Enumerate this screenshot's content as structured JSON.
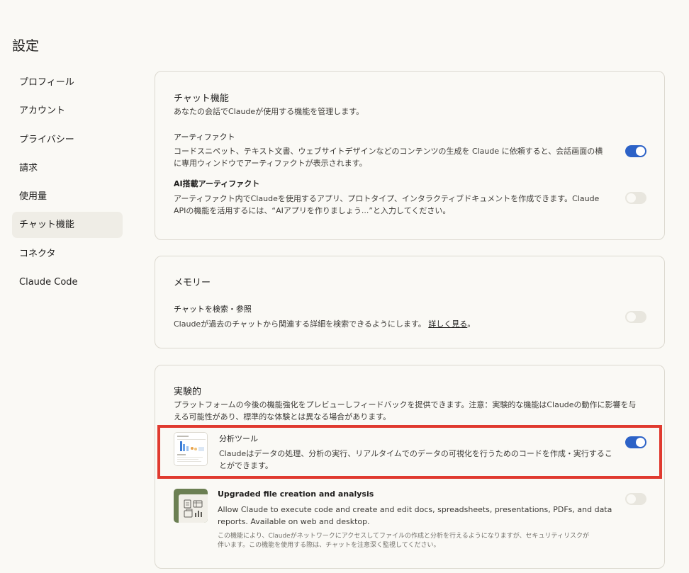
{
  "page": {
    "title": "設定"
  },
  "sidebar": {
    "items": [
      {
        "label": "プロフィール",
        "active": false
      },
      {
        "label": "アカウント",
        "active": false
      },
      {
        "label": "プライバシー",
        "active": false
      },
      {
        "label": "請求",
        "active": false
      },
      {
        "label": "使用量",
        "active": false
      },
      {
        "label": "チャット機能",
        "active": true
      },
      {
        "label": "コネクタ",
        "active": false
      },
      {
        "label": "Claude Code",
        "active": false
      }
    ]
  },
  "chat_features": {
    "title": "チャット機能",
    "description": "あなたの会話でClaudeが使用する機能を管理します。",
    "artifacts": {
      "label": "アーティファクト",
      "desc_line1": "コードスニペット、テキスト文書、ウェブサイトデザインなどのコンテンツの生成を Claude に依頼すると、会話画面の横",
      "desc_line2": "に専用ウィンドウでアーティファクトが表示されます。",
      "enabled": true
    },
    "ai_artifacts": {
      "label": "AI搭載アーティファクト",
      "desc_line1": "アーティファクト内でClaudeを使用するアプリ、プロトタイプ、インタラクティブドキュメントを作成できます。Claude",
      "desc_line2": "APIの機能を活用するには、“AIアプリを作りましょう...”と入力してください。",
      "enabled": false
    }
  },
  "memory": {
    "title": "メモリー",
    "search_chats": {
      "label": "チャットを検索・参照",
      "desc": "Claudeが過去のチャットから関連する詳細を検索できるようにします。",
      "link": "詳しく見る",
      "link_suffix": "。",
      "enabled": false
    }
  },
  "experimental": {
    "title": "実験的",
    "desc_line1": "プラットフォームの今後の機能強化をプレビューしフィードバックを提供できます。注意：実験的な機能はClaudeの動作に影響を与",
    "desc_line2": "える可能性があり、標準的な体験とは異なる場合があります。",
    "analysis_tool": {
      "label": "分析ツール",
      "desc_line1": "Claudeはデータの処理、分析の実行、リアルタイムでのデータの可視化を行うためのコードを作成・実行するこ",
      "desc_line2": "とができます。",
      "enabled": true
    },
    "file_creation": {
      "label": "Upgraded file creation and analysis",
      "desc_line1": "Allow Claude to execute code and create and edit docs, spreadsheets, presentations, PDFs, and data",
      "desc_line2": "reports. Available on web and desktop.",
      "note_line1": "この機能により、Claudeがネットワークにアクセスしてファイルの作成と分析を行えるようになりますが、セキュリティリスクが",
      "note_line2": "伴います。この機能を使用する際は、チャットを注意深く監視してください。",
      "enabled": false
    }
  },
  "colors": {
    "toggle_on": "#2c62c7",
    "toggle_off": "#e8e6de",
    "highlight": "#e03a2f",
    "background": "#faf9f5"
  }
}
